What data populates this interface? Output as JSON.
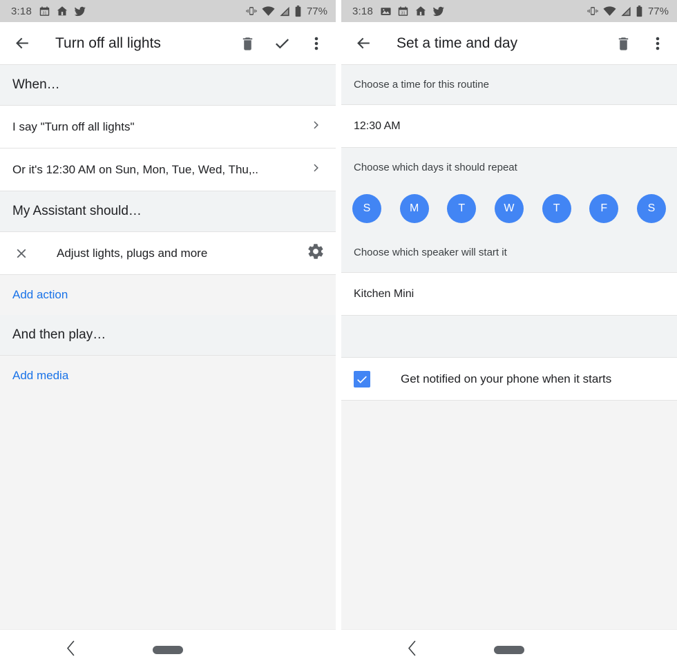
{
  "left": {
    "statusbar": {
      "time": "3:18",
      "battery_percent": "77%",
      "left_icons": [
        "calendar-icon",
        "home-icon",
        "twitter-icon"
      ],
      "right_icons": [
        "vibrate-icon",
        "wifi-icon",
        "signal-icon",
        "battery-icon"
      ]
    },
    "appbar": {
      "back_icon": "arrow-back-icon",
      "title": "Turn off all lights",
      "actions": [
        "delete-icon",
        "check-icon",
        "overflow-icon"
      ]
    },
    "sections": {
      "when_header": "When…",
      "trigger_voice": "I say \"Turn off all lights\"",
      "trigger_time": "Or it's 12:30 AM on Sun, Mon, Tue, Wed, Thu,..",
      "assistant_header": "My Assistant should…",
      "action_label": "Adjust lights, plugs and more",
      "add_action": "Add action",
      "play_header": "And then play…",
      "add_media": "Add media"
    },
    "navbar": {
      "back_icon": "nav-back-icon",
      "home_pill": "nav-home-pill"
    }
  },
  "right": {
    "statusbar": {
      "time": "3:18",
      "battery_percent": "77%",
      "left_icons": [
        "image-icon",
        "calendar-icon",
        "home-icon",
        "twitter-icon"
      ],
      "right_icons": [
        "vibrate-icon",
        "wifi-icon",
        "signal-icon",
        "battery-icon"
      ]
    },
    "appbar": {
      "back_icon": "arrow-back-icon",
      "title": "Set a time and day",
      "actions": [
        "delete-icon",
        "overflow-icon"
      ]
    },
    "sections": {
      "time_header": "Choose a time for this routine",
      "time_value": "12:30 AM",
      "days_header": "Choose which days it should repeat",
      "days": [
        {
          "label": "S",
          "selected": true
        },
        {
          "label": "M",
          "selected": true
        },
        {
          "label": "T",
          "selected": true
        },
        {
          "label": "W",
          "selected": true
        },
        {
          "label": "T",
          "selected": true
        },
        {
          "label": "F",
          "selected": true
        },
        {
          "label": "S",
          "selected": true
        }
      ],
      "speaker_header": "Choose which speaker will start it",
      "speaker_value": "Kitchen Mini",
      "notify_label": "Get notified on your phone when it starts",
      "notify_checked": true
    },
    "navbar": {
      "back_icon": "nav-back-icon",
      "home_pill": "nav-home-pill"
    }
  },
  "colors": {
    "accent_blue": "#4285f4",
    "link_blue": "#1a73e8",
    "statusbar_grey": "#d2d2d2",
    "section_grey": "#f1f3f4",
    "page_grey": "#f4f4f4",
    "text_primary": "#202124"
  }
}
